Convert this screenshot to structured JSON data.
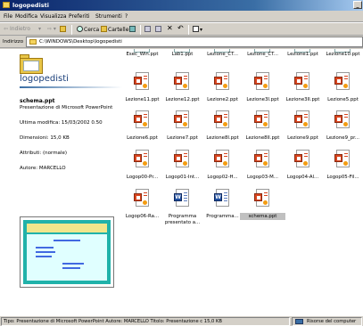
{
  "window": {
    "title": "logopedisti"
  },
  "menu": [
    "File",
    "Modifica",
    "Visualizza",
    "Preferiti",
    "Strumenti",
    "?"
  ],
  "toolbar": {
    "back_label": "Indietro",
    "search_label": "Cerca",
    "folders_label": "Cartelle"
  },
  "address": {
    "label": "Indirizzo",
    "path": "C:\\WINDOWS\\Desktop\\logopedisti"
  },
  "left_pane": {
    "folder_title": "logopedisti",
    "file_name": "schema.ppt",
    "file_type": "Presentazione di Microsoft PowerPoint",
    "modified": "Ultima modifica: 15/03/2002 0.50",
    "size": "Dimensioni: 15,0 KB",
    "attributes": "Attributi: (normale)",
    "author": "Autore: MARCELLO"
  },
  "top_row_files": [
    "Esec_Win.ppt",
    "Lab1.ppt",
    "Lezione_CT...",
    "Lezione_CT...",
    "Lezione1.ppt",
    "Lezione10.ppt"
  ],
  "files": [
    {
      "name": "Lezione11.ppt",
      "type": "ppt"
    },
    {
      "name": "Lezione12.ppt",
      "type": "ppt"
    },
    {
      "name": "Lezione2.ppt",
      "type": "ppt"
    },
    {
      "name": "Lezione3I.ppt",
      "type": "ppt"
    },
    {
      "name": "Lezione3II.ppt",
      "type": "ppt"
    },
    {
      "name": "Lezione5.ppt",
      "type": "ppt"
    },
    {
      "name": "Lezione6.ppt",
      "type": "ppt"
    },
    {
      "name": "Lezione7.ppt",
      "type": "ppt"
    },
    {
      "name": "Lezione8I.ppt",
      "type": "ppt"
    },
    {
      "name": "Lezione8II.ppt",
      "type": "ppt"
    },
    {
      "name": "Lezione9.ppt",
      "type": "ppt"
    },
    {
      "name": "Lezione9_pr...",
      "type": "ppt"
    },
    {
      "name": "Logop00-Pr...",
      "type": "ppt"
    },
    {
      "name": "Logop01-Int...",
      "type": "ppt"
    },
    {
      "name": "Logop02-H...",
      "type": "ppt"
    },
    {
      "name": "Logop03-M...",
      "type": "ppt"
    },
    {
      "name": "Logop04-Al...",
      "type": "ppt"
    },
    {
      "name": "Logop05-Fil...",
      "type": "ppt"
    },
    {
      "name": "Logop06-Ra...",
      "type": "ppt"
    },
    {
      "name": "Programma",
      "name2": "presentato a...",
      "type": "doc"
    },
    {
      "name": "Programma...",
      "type": "doc"
    },
    {
      "name": "schema.ppt",
      "type": "ppt",
      "selected": true
    }
  ],
  "status": {
    "text": "Tipo: Presentazione di Microsoft PowerPoint Autore: MARCELLO Titolo: Presentazione c 15,0 KB",
    "zone": "Risorse del computer"
  }
}
